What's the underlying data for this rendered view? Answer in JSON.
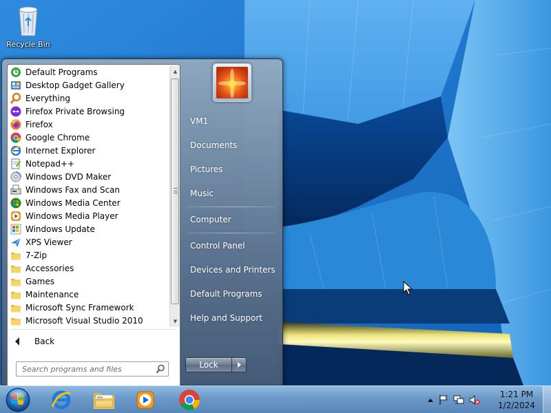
{
  "desktop": {
    "icons": [
      {
        "label": "Recycle Bin",
        "icon": "recycle-bin-icon"
      }
    ]
  },
  "start_menu": {
    "programs": [
      {
        "label": "Default Programs",
        "icon": "default-programs-icon"
      },
      {
        "label": "Desktop Gadget Gallery",
        "icon": "gadget-gallery-icon"
      },
      {
        "label": "Everything",
        "icon": "everything-search-icon"
      },
      {
        "label": "Firefox Private Browsing",
        "icon": "firefox-private-icon"
      },
      {
        "label": "Firefox",
        "icon": "firefox-icon"
      },
      {
        "label": "Google Chrome",
        "icon": "chrome-icon"
      },
      {
        "label": "Internet Explorer",
        "icon": "ie-icon"
      },
      {
        "label": "Notepad++",
        "icon": "notepadpp-icon"
      },
      {
        "label": "Windows DVD Maker",
        "icon": "dvd-maker-icon"
      },
      {
        "label": "Windows Fax and Scan",
        "icon": "fax-scan-icon"
      },
      {
        "label": "Windows Media Center",
        "icon": "media-center-icon"
      },
      {
        "label": "Windows Media Player",
        "icon": "media-player-icon"
      },
      {
        "label": "Windows Update",
        "icon": "windows-update-icon"
      },
      {
        "label": "XPS Viewer",
        "icon": "xps-viewer-icon"
      },
      {
        "label": "7-Zip",
        "icon": "folder-icon"
      },
      {
        "label": "Accessories",
        "icon": "folder-icon"
      },
      {
        "label": "Games",
        "icon": "folder-icon"
      },
      {
        "label": "Maintenance",
        "icon": "folder-icon"
      },
      {
        "label": "Microsoft Sync Framework",
        "icon": "folder-icon"
      },
      {
        "label": "Microsoft Visual Studio 2010",
        "icon": "folder-icon"
      }
    ],
    "back_label": "Back",
    "search_placeholder": "Search programs and files",
    "right_links": [
      {
        "label": "VM1"
      },
      {
        "label": "Documents"
      },
      {
        "label": "Pictures"
      },
      {
        "label": "Music"
      },
      {
        "label": "Computer"
      },
      {
        "label": "Control Panel"
      },
      {
        "label": "Devices and Printers"
      },
      {
        "label": "Default Programs"
      },
      {
        "label": "Help and Support"
      }
    ],
    "lock_label": "Lock"
  },
  "taskbar": {
    "pinned": [
      {
        "name": "internet-explorer",
        "icon": "ie-icon"
      },
      {
        "name": "windows-explorer",
        "icon": "explorer-folder-icon"
      },
      {
        "name": "windows-media-player",
        "icon": "media-player-icon"
      },
      {
        "name": "google-chrome",
        "icon": "chrome-icon"
      }
    ],
    "clock": {
      "time": "1:21 PM",
      "date": "1/2/2024"
    }
  },
  "colors": {
    "menu_frame": "#6e8296",
    "taskbar": "#7fa8d2",
    "wallpaper_sky": "#1b74c8"
  }
}
